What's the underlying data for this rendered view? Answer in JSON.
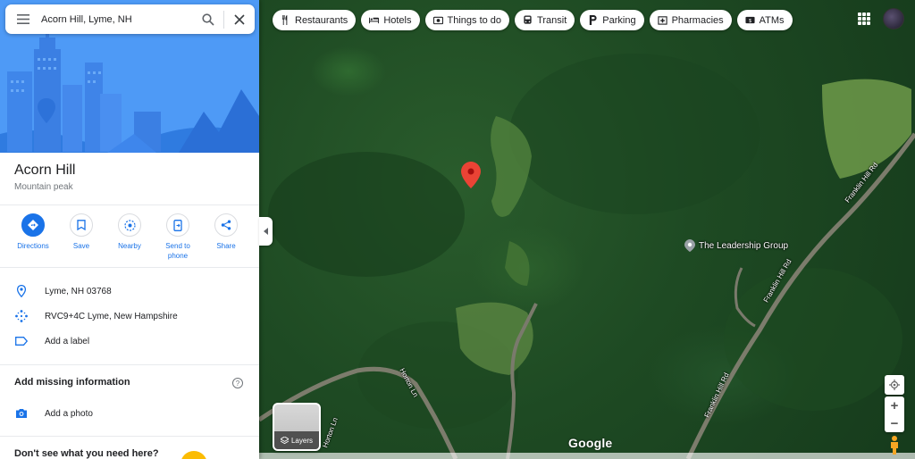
{
  "search": {
    "query": "Acorn Hill, Lyme, NH"
  },
  "place": {
    "name": "Acorn Hill",
    "category": "Mountain peak",
    "actions": [
      {
        "label": "Directions"
      },
      {
        "label": "Save"
      },
      {
        "label": "Nearby"
      },
      {
        "label": "Send to phone"
      },
      {
        "label": "Share"
      }
    ],
    "info": [
      {
        "icon": "location-pin-icon",
        "text": "Lyme, NH 03768"
      },
      {
        "icon": "plus-code-icon",
        "text": "RVC9+4C Lyme, New Hampshire"
      },
      {
        "icon": "label-icon",
        "text": "Add a label"
      }
    ],
    "missing_title": "Add missing information",
    "add_photo": "Add a photo",
    "dont_see": "Don't see what you need here?"
  },
  "chips": [
    {
      "icon": "restaurant-icon",
      "label": "Restaurants"
    },
    {
      "icon": "hotel-icon",
      "label": "Hotels"
    },
    {
      "icon": "camera-icon",
      "label": "Things to do"
    },
    {
      "icon": "transit-icon",
      "label": "Transit"
    },
    {
      "icon": "parking-icon",
      "label": "Parking"
    },
    {
      "icon": "pharmacy-icon",
      "label": "Pharmacies"
    },
    {
      "icon": "atm-icon",
      "label": "ATMs"
    }
  ],
  "map": {
    "poi": "The Leadership Group",
    "roads": {
      "franklin_1": "Franklin Hill Rd",
      "franklin_2": "Franklin Hill Rd",
      "franklin_3": "Franklin Hill Rd",
      "horton": "Horton Ln",
      "horton_2": "Horton Ln"
    },
    "layers_label": "Layers",
    "logo": "Google"
  },
  "colors": {
    "accent": "#1a73e8",
    "pin": "#ea4335",
    "hero": "#4e9af6"
  }
}
